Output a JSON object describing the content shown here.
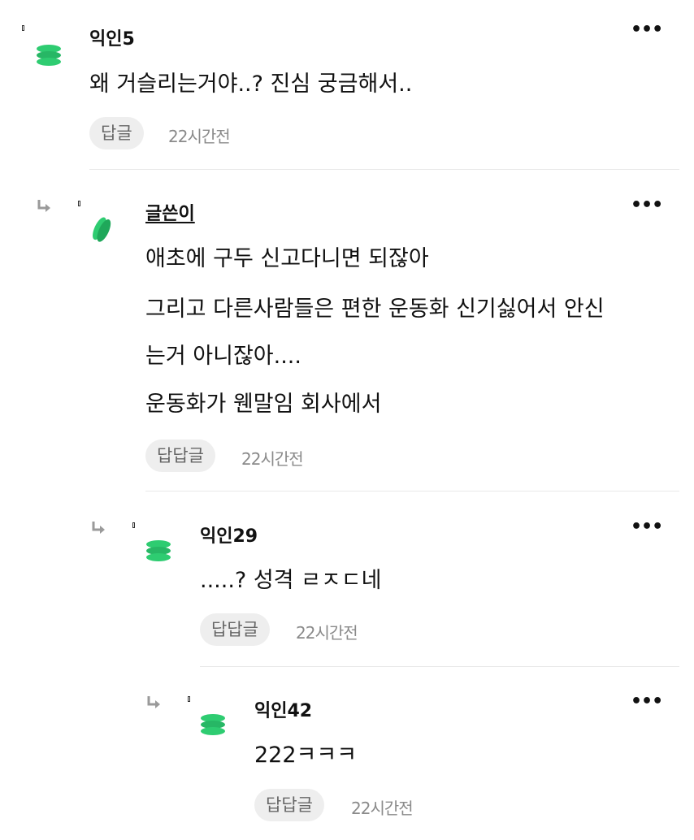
{
  "comments": [
    {
      "author": "익인5",
      "lines": [
        "왜 거슬리는거야..? 진심 궁금해서.."
      ],
      "reply_label": "답글",
      "time": "22시간전",
      "more": "•••"
    },
    {
      "author": "글쓴이",
      "lines": [
        "애초에 구두 신고다니면 되잖아",
        "그리고 다른사람들은 편한 운동화 신기싫어서 안신",
        "는거 아니잖아....",
        "운동화가 웬말임 회사에서"
      ],
      "reply_label": "답답글",
      "time": "22시간전",
      "more": "•••"
    },
    {
      "author": "익인29",
      "lines": [
        ".....? 성격 ㄹㅈㄷ네"
      ],
      "reply_label": "답답글",
      "time": "22시간전",
      "more": "•••"
    },
    {
      "author": "익인42",
      "lines": [
        "222ㅋㅋㅋ"
      ],
      "reply_label": "답답글",
      "time": "22시간전",
      "more": "•••"
    }
  ],
  "colors": {
    "avatar_green": "#2ecc71",
    "avatar_dark": "#1fa85a"
  },
  "icons": {
    "reply_indent": "reply-arrow-icon",
    "avatar": "green-stack-avatar-icon",
    "more": "more-options-icon"
  }
}
